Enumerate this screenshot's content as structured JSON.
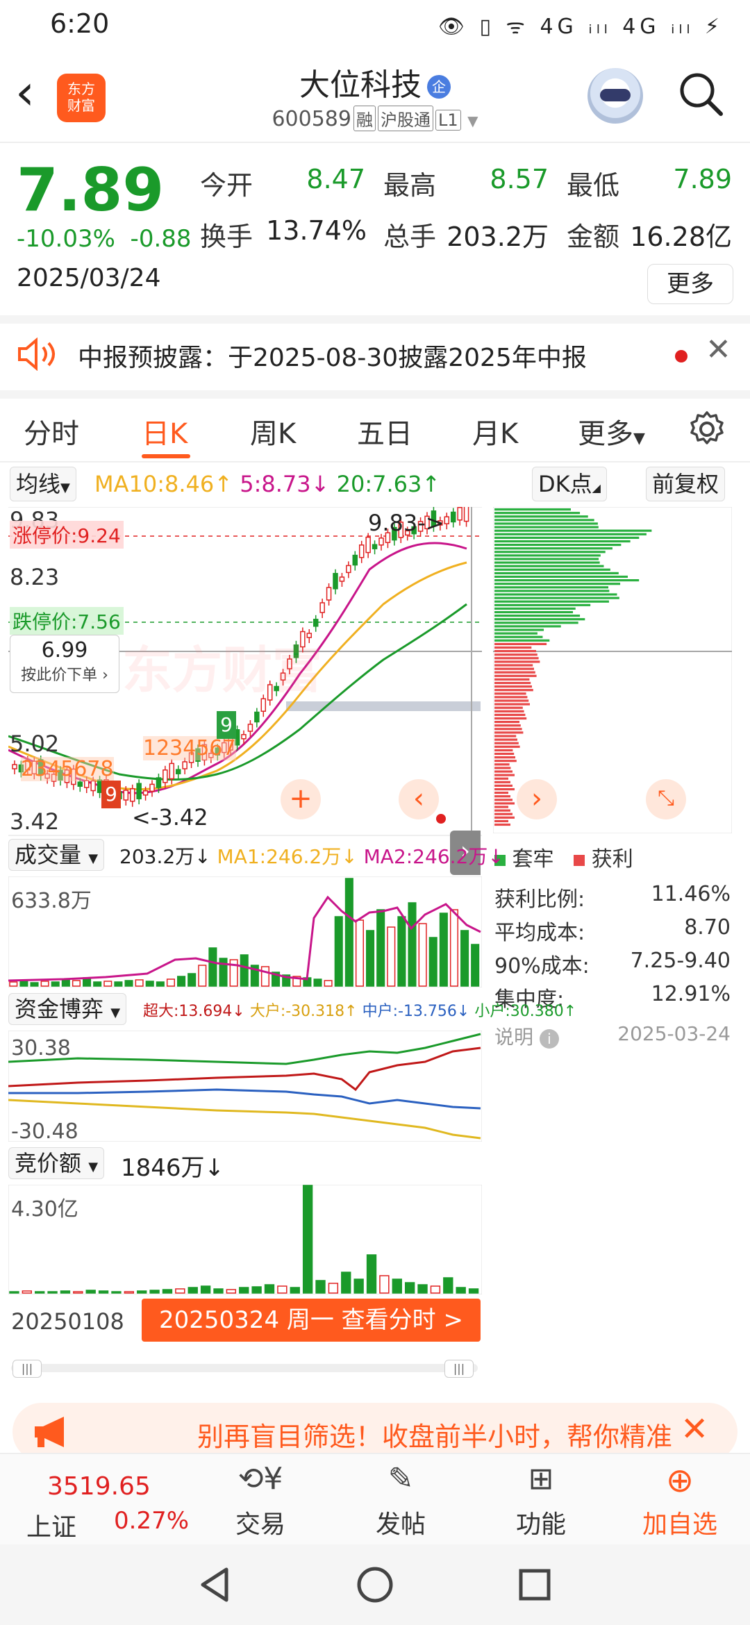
{
  "status_bar": {
    "time": "6:20",
    "icons": "👁 ▯ ᯤ 4G ᵢₗₗ 4G ᵢₗₗ ⚡"
  },
  "header": {
    "logo": "东方财富",
    "stock_name": "大位科技",
    "badge": "企",
    "stock_code": "600589",
    "tags": [
      "融",
      "沪股通",
      "L1"
    ]
  },
  "quote": {
    "price": "7.89",
    "change_pct": "-10.03%",
    "change_abs": "-0.88",
    "date": "2025/03/24",
    "open_label": "今开",
    "open": "8.47",
    "high_label": "最高",
    "high": "8.57",
    "low_label": "最低",
    "low": "7.89",
    "turnover_label": "换手",
    "turnover": "13.74%",
    "volume_label": "总手",
    "volume": "203.2万",
    "amount_label": "金额",
    "amount": "16.28亿",
    "more": "更多"
  },
  "notice": {
    "text": "中报预披露：于2025-08-30披露2025年中报"
  },
  "tabs": [
    "分时",
    "日K",
    "周K",
    "五日",
    "月K",
    "更多"
  ],
  "indicator_bar": {
    "ma_button": "均线",
    "ma10": "MA10:8.46↑",
    "ma5": "5:8.73↓",
    "ma20": "20:7.63↑",
    "dk": "DK点",
    "fq": "前复权"
  },
  "kchart": {
    "y_top": "9.83",
    "y_mid": "8.23",
    "y_low": "5.02",
    "y_bottom": "3.42",
    "limit_up": "涨停价:9.24",
    "limit_down": "跌停价:7.56",
    "order_price": "6.99",
    "order_label": "按此价下单",
    "high_marker": "9.83->",
    "low_marker": "<-3.42",
    "watermark": "东方财富",
    "seq_a": "2345678",
    "seq_a_end": "9",
    "seq_b": "1234567",
    "seq_b_end": "9"
  },
  "side_panel": {
    "legend_trapped": "套牢",
    "legend_profit": "获利",
    "rows": [
      {
        "label": "获利比例:",
        "value": "11.46%"
      },
      {
        "label": "平均成本:",
        "value": "8.70"
      },
      {
        "label": "90%成本:",
        "value": "7.25-9.40"
      },
      {
        "label": "集中度:",
        "value": "12.91%"
      }
    ],
    "note_label": "说明",
    "note_date": "2025-03-24"
  },
  "volume": {
    "label": "成交量",
    "value": "203.2万↓",
    "ma1": "MA1:246.2万↓",
    "ma2": "MA2:246.2万↓",
    "max": "633.8万"
  },
  "capital": {
    "label": "资金博弈",
    "big": "超大:13.694↓",
    "large": "大户:-30.318↑",
    "mid": "中户:-13.756↓",
    "small": "小户:30.380↑",
    "max": "30.38",
    "min": "-30.48"
  },
  "auction": {
    "label": "竞价额",
    "value": "1846万↓",
    "max": "4.30亿"
  },
  "timeline": {
    "start": "20250108",
    "current": "20250324 周一 查看分时 >"
  },
  "promo": {
    "text": "别再盲目筛选！收盘前半小时，帮你精准"
  },
  "bottom_nav": {
    "index_value": "3519.65",
    "index_name": "上证",
    "index_change": "0.27%",
    "items": [
      "交易",
      "发帖",
      "功能",
      "加自选"
    ]
  },
  "colors": {
    "up": "#e02020",
    "down": "#1a9a2a",
    "accent": "#ff5a1e",
    "ma5": "#c8158a",
    "ma10": "#f0b020",
    "ma20": "#1a9a2a"
  }
}
